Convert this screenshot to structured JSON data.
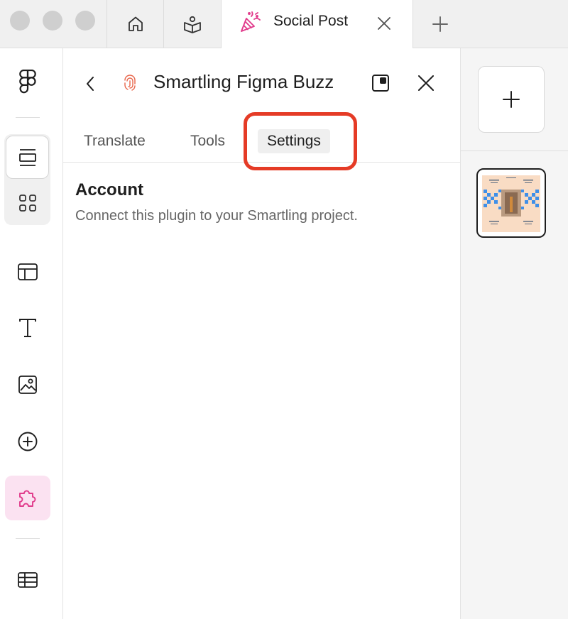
{
  "tab": {
    "title": "Social Post",
    "icon": "party-popper-icon"
  },
  "plugin": {
    "name": "Smartling Figma Buzz",
    "tabs": [
      {
        "label": "Translate"
      },
      {
        "label": "Tools"
      },
      {
        "label": "Settings",
        "active": true
      }
    ],
    "account": {
      "title": "Account",
      "description": "Connect this plugin to your Smartling project."
    }
  },
  "colors": {
    "accent_pink": "#e13c8c",
    "highlight_red": "#e53b26",
    "plugin_icon": "#e8654a"
  }
}
